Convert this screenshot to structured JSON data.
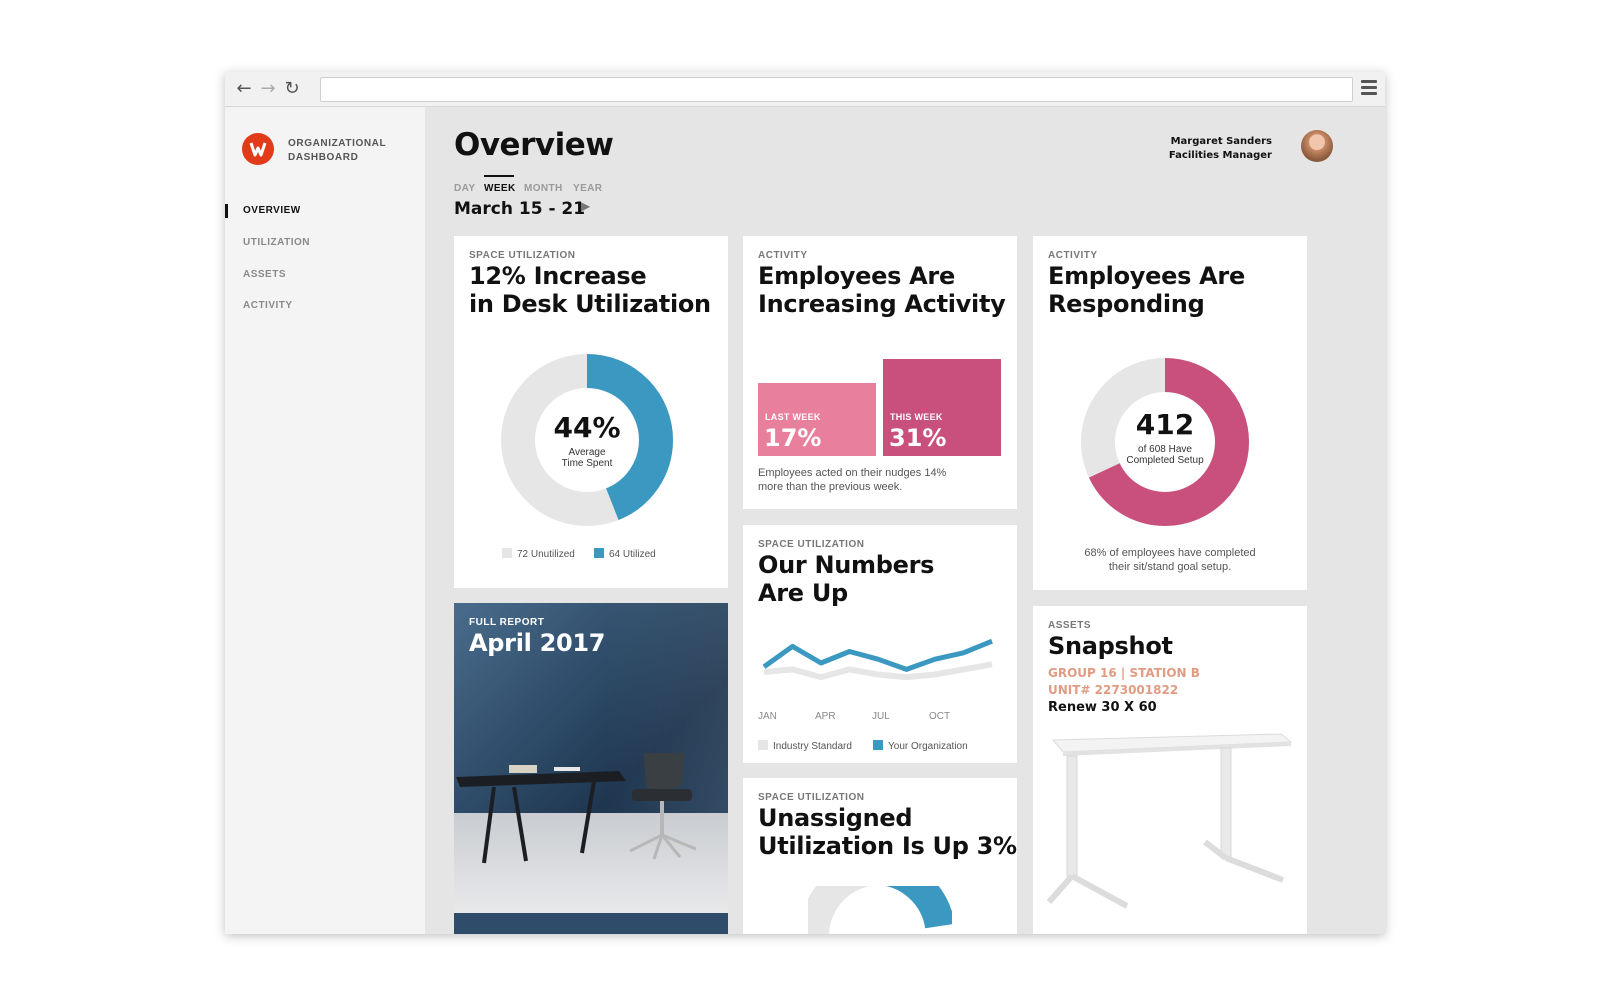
{
  "colors": {
    "accent_blue": "#3a98c1",
    "accent_pink": "#c94f7c",
    "light_pink": "#e87f9c",
    "gray": "#e6e6e6",
    "brand_red": "#e13b1a",
    "asset_salmon": "#e09c82"
  },
  "browser": {
    "back_icon": "arrow-left-icon",
    "forward_icon": "arrow-right-icon",
    "reload_icon": "reload-icon",
    "menu_icon": "hamburger-menu-icon",
    "url": ""
  },
  "sidebar": {
    "brand_line1": "ORGANIZATIONAL",
    "brand_line2": "DASHBOARD",
    "items": [
      {
        "label": "OVERVIEW",
        "active": true
      },
      {
        "label": "UTILIZATION",
        "active": false
      },
      {
        "label": "ASSETS",
        "active": false
      },
      {
        "label": "ACTIVITY",
        "active": false
      }
    ]
  },
  "header": {
    "title": "Overview",
    "user_name": "Margaret Sanders",
    "user_role": "Facilities Manager",
    "periods": [
      "DAY",
      "WEEK",
      "MONTH",
      "YEAR"
    ],
    "active_period": "WEEK",
    "date_range": "March 15 - 21"
  },
  "cards": {
    "desk": {
      "eyebrow": "SPACE UTILIZATION",
      "title_line1": "12% Increase",
      "title_line2": "in Desk Utilization",
      "center_value": "44%",
      "center_label_line1": "Average",
      "center_label_line2": "Time Spent",
      "fraction": 0.44,
      "legend_unutilized": "72 Unutilized",
      "legend_utilized": "64 Utilized"
    },
    "activity": {
      "eyebrow": "ACTIVITY",
      "title_line1": "Employees Are",
      "title_line2": "Increasing Activity",
      "last_week_label": "LAST WEEK",
      "last_week_value": "17%",
      "this_week_label": "THIS WEEK",
      "this_week_value": "31%",
      "note_line1": "Employees acted on their nudges 14%",
      "note_line2": "more than the previous week."
    },
    "responding": {
      "eyebrow": "ACTIVITY",
      "title_line1": "Employees Are",
      "title_line2": "Responding",
      "center_value": "412",
      "center_label_line1": "of 608 Have",
      "center_label_line2": "Completed Setup",
      "fraction": 0.68,
      "note_line1": "68% of employees have completed",
      "note_line2": "their sit/stand goal setup."
    },
    "report": {
      "eyebrow": "FULL REPORT",
      "title": "April 2017"
    },
    "numbers": {
      "eyebrow": "SPACE UTILIZATION",
      "title_line1": "Our Numbers",
      "title_line2": "Are Up",
      "legend_industry": "Industry Standard",
      "legend_org": "Your Organization"
    },
    "snapshot": {
      "eyebrow": "ASSETS",
      "title": "Snapshot",
      "line1": "GROUP 16 | STATION B",
      "line2": "UNIT# 2273001822",
      "line3": "Renew 30 X 60"
    },
    "unassigned": {
      "eyebrow": "SPACE UTILIZATION",
      "title_line1": "Unassigned",
      "title_line2": "Utilization Is Up 3%"
    }
  },
  "chart_data": {
    "type": "line",
    "categories": [
      "JAN",
      "APR",
      "JUL",
      "OCT"
    ],
    "x": [
      0,
      1,
      2,
      3,
      4,
      5,
      6,
      7,
      8
    ],
    "series": [
      {
        "name": "Your Organization",
        "values": [
          52,
          68,
          55,
          64,
          58,
          50,
          58,
          63,
          72
        ]
      },
      {
        "name": "Industry Standard",
        "values": [
          48,
          50,
          44,
          50,
          46,
          44,
          46,
          50,
          54
        ]
      }
    ],
    "ylim": [
      30,
      80
    ],
    "grid": false,
    "legend": "bottom"
  }
}
